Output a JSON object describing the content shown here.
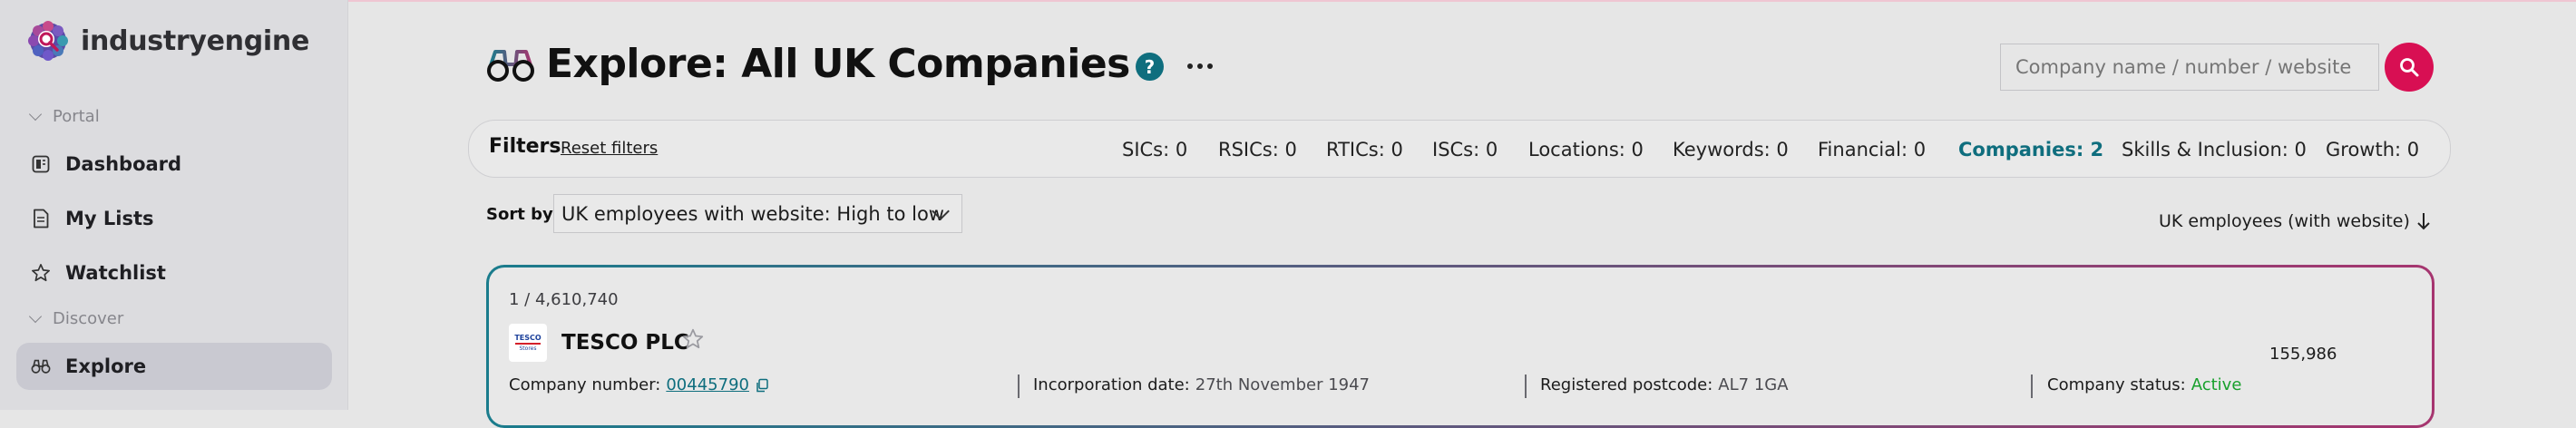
{
  "brand": {
    "name": "industryengine"
  },
  "sidebar": {
    "sections": [
      {
        "label": "Portal"
      },
      {
        "label": "Discover"
      }
    ],
    "items": [
      {
        "label": "Dashboard",
        "icon": "dashboard-icon"
      },
      {
        "label": "My Lists",
        "icon": "document-icon"
      },
      {
        "label": "Watchlist",
        "icon": "star-icon"
      },
      {
        "label": "Explore",
        "icon": "binoculars-icon",
        "active": true
      }
    ]
  },
  "header": {
    "title": "Explore: All UK Companies",
    "help_label": "?",
    "search_placeholder": "Company name / number / website"
  },
  "filters": {
    "title": "Filters",
    "reset_label": "Reset filters",
    "chips": [
      {
        "label": "SICs: 0"
      },
      {
        "label": "RSICs: 0"
      },
      {
        "label": "RTICs: 0"
      },
      {
        "label": "ISCs: 0"
      },
      {
        "label": "Locations: 0"
      },
      {
        "label": "Keywords: 0"
      },
      {
        "label": "Financial: 0"
      },
      {
        "label": "Companies: 2",
        "active": true
      },
      {
        "label": "Skills & Inclusion: 0"
      },
      {
        "label": "Growth: 0"
      }
    ]
  },
  "sort": {
    "label": "Sort by:",
    "selected": "UK employees with website: High to low",
    "column_label": "UK employees (with website)"
  },
  "results": [
    {
      "rank": "1 / 4,610,740",
      "logo_text_top": "TESCO",
      "logo_text_bottom": "Stores",
      "name": "TESCO PLC",
      "metric": "155,986",
      "company_number_label": "Company number:",
      "company_number": "00445790",
      "incorporation_label": "Incorporation date:",
      "incorporation_date": "27th November 1947",
      "postcode_label": "Registered postcode:",
      "postcode": "AL7 1GA",
      "status_label": "Company status:",
      "status": "Active"
    }
  ],
  "colors": {
    "accent": "#0f6e7e",
    "brand": "#d80f53",
    "status_active": "#18a02c"
  }
}
